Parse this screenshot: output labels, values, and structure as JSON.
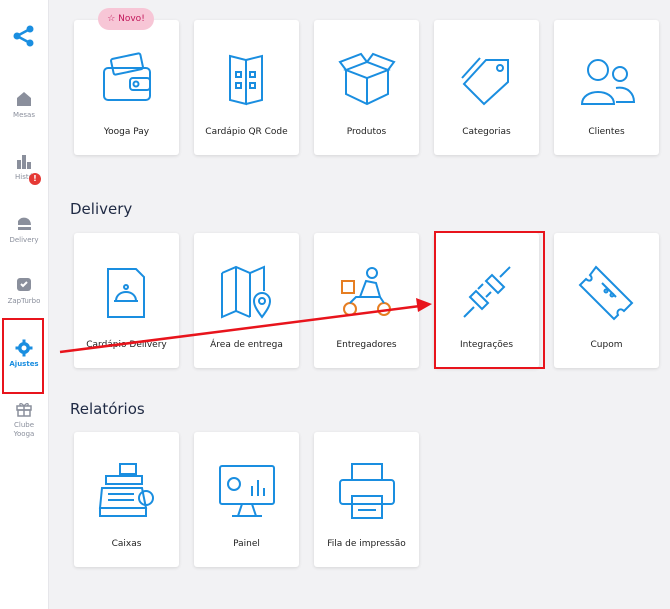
{
  "sidebar": {
    "items": [
      {
        "label": "Mesas",
        "icon": "home-icon"
      },
      {
        "label": "Histó",
        "icon": "bar-chart-icon",
        "badge": "!"
      },
      {
        "label": "Delivery",
        "icon": "delivery-icon"
      },
      {
        "label": "ZapTurbo",
        "icon": "zapturbo-icon"
      },
      {
        "label": "Ajustes",
        "icon": "gear-icon",
        "active": true
      },
      {
        "label": "Clube Yooga",
        "icon": "gift-icon"
      }
    ]
  },
  "badge_new": "☆ Novo!",
  "sections": {
    "cadastros": {
      "cards": [
        "Yooga Pay",
        "Cardápio QR Code",
        "Produtos",
        "Categorias",
        "Clientes"
      ]
    },
    "delivery": {
      "title": "Delivery",
      "cards": [
        "Cardápio Delivery",
        "Área de entrega",
        "Entregadores",
        "Integrações",
        "Cupom"
      ]
    },
    "relatorios": {
      "title": "Relatórios",
      "cards": [
        "Caixas",
        "Painel",
        "Fila de impressão"
      ]
    }
  },
  "colors": {
    "accent": "#1a8ee0",
    "highlight": "#e8141c",
    "badge": "#f7c6d6"
  }
}
